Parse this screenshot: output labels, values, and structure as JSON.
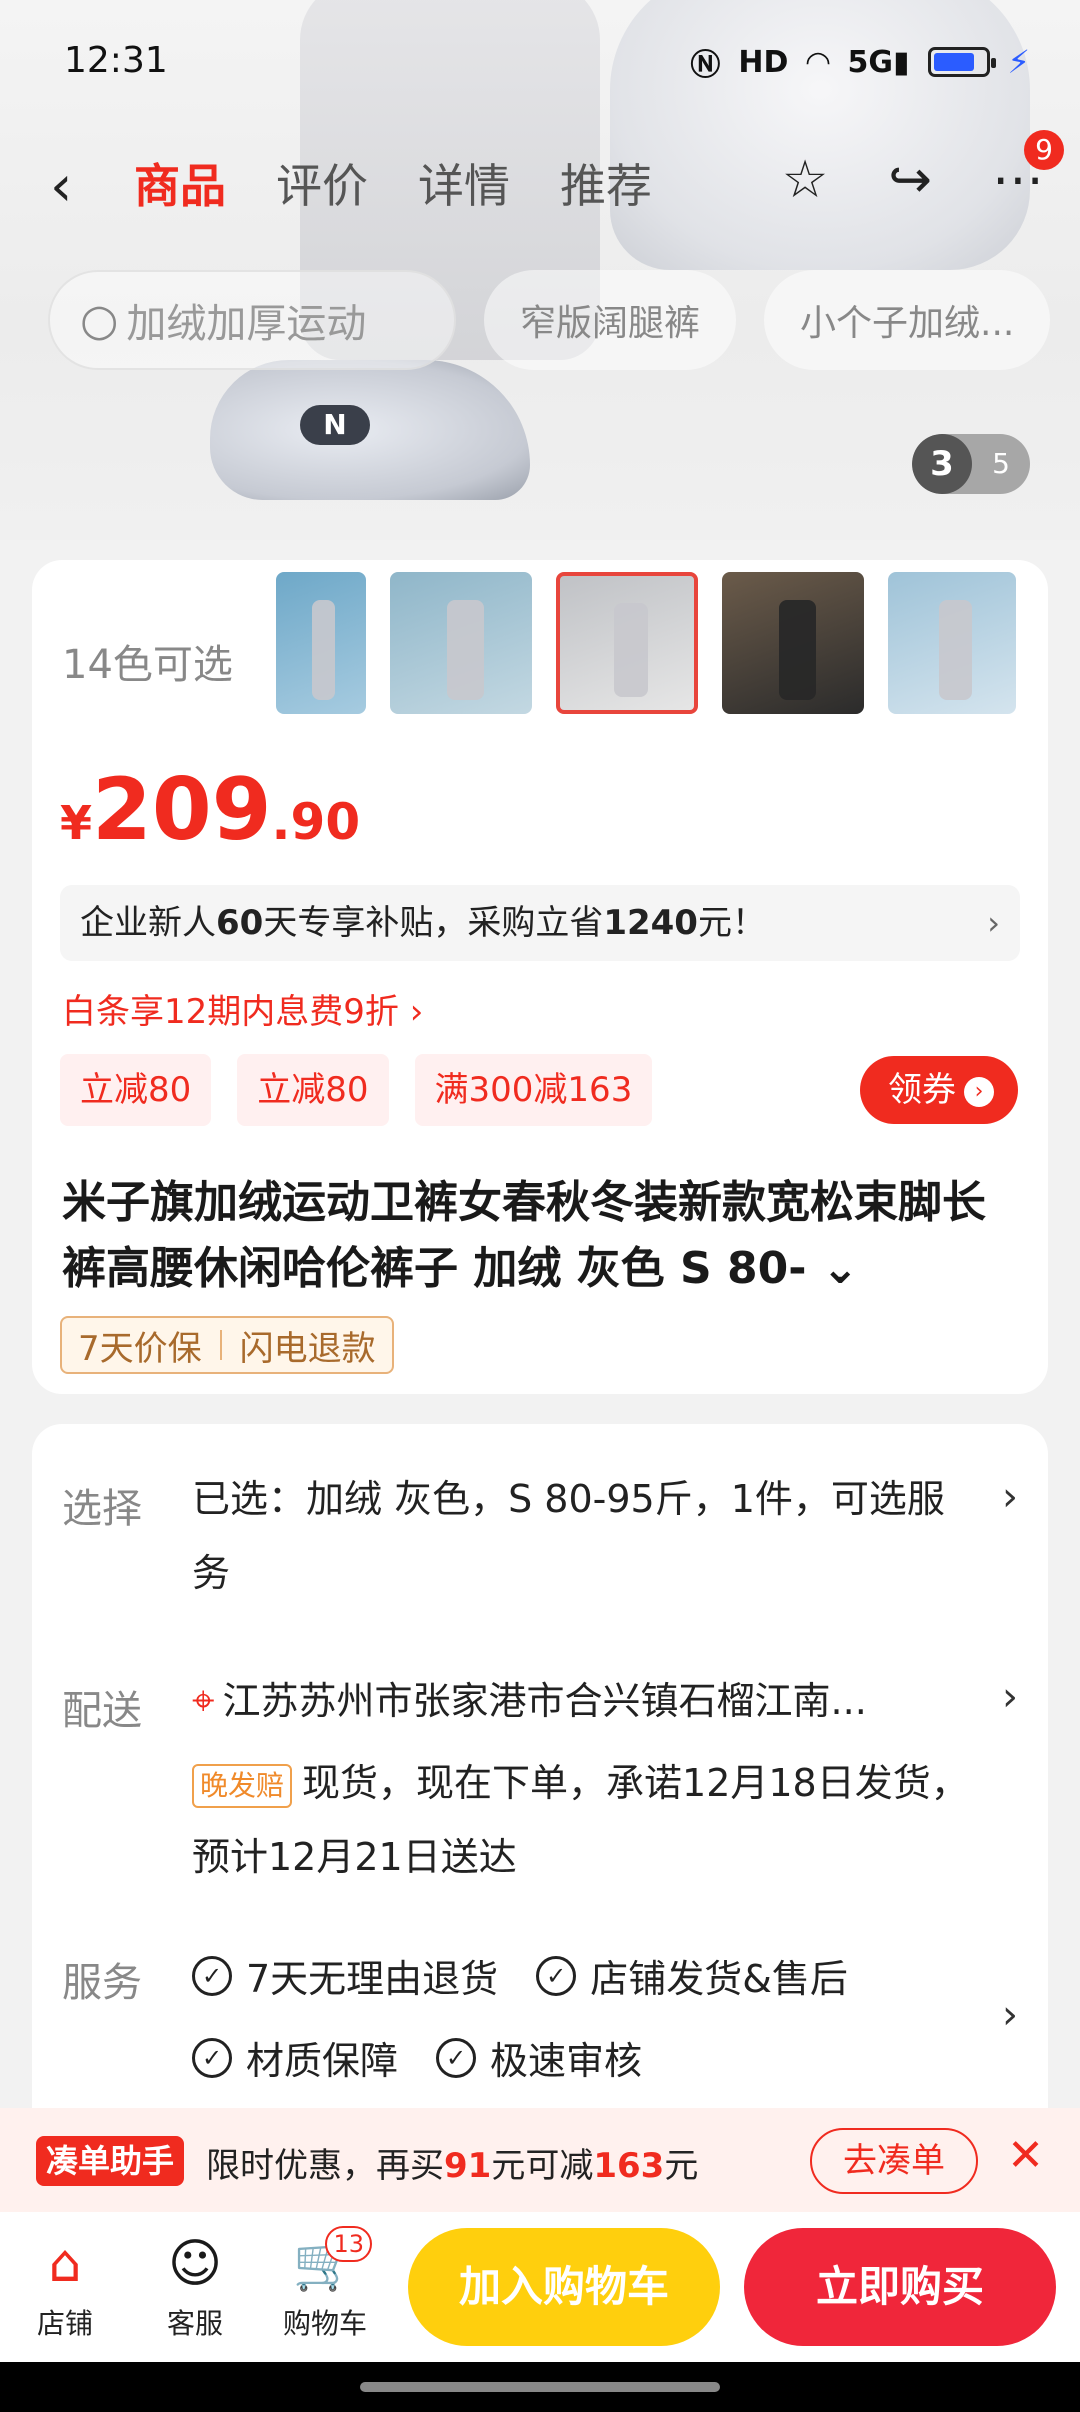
{
  "status_bar": {
    "time": "12:31",
    "icons": [
      "nfc-icon",
      "hd-icon",
      "wifi-icon",
      "5g-signal-icon",
      "battery-icon",
      "charging-icon"
    ],
    "network": "5G",
    "hd": "HD"
  },
  "nav": {
    "tabs": [
      {
        "label": "商品",
        "active": true
      },
      {
        "label": "评价",
        "active": false
      },
      {
        "label": "详情",
        "active": false
      },
      {
        "label": "推荐",
        "active": false
      }
    ],
    "more_badge": "9"
  },
  "search": {
    "placeholder": "加绒加厚运动",
    "chips": [
      "窄版阔腿裤",
      "小个子加绒..."
    ]
  },
  "image_counter": {
    "current": "3",
    "total": "5"
  },
  "product": {
    "colors_label": "14色可选",
    "price": {
      "currency": "¥",
      "integer": "209",
      "decimal": ".90"
    },
    "subsidy": {
      "prefix": "企业新人",
      "days": "60",
      "mid": "天专享补贴，采购立省",
      "amount": "1240",
      "suffix": "元！",
      "arrow": "›"
    },
    "baitiao": "白条享12期内息费9折 ›",
    "promos": [
      "立减80",
      "立减80",
      "满300减163"
    ],
    "coupon_label": "领券",
    "title": "米子旗加绒运动卫裤女春秋冬装新款宽松束脚长裤高腰休闲哈伦裤子 加绒 灰色 S 80- ⌄",
    "guarantees": [
      "7天价保",
      "闪电退款"
    ]
  },
  "selection": {
    "select_label": "选择",
    "select_text": "已选：加绒 灰色，S 80-95斤，1件，可选服务",
    "delivery_label": "配送",
    "address": "江苏苏州市张家港市合兴镇石榴江南...",
    "late_tag": "晚发赔",
    "delivery_text": "现货，现在下单，承诺12月18日发货，预计12月21日送达",
    "service_label": "服务",
    "services": [
      "7天无理由退货",
      "店铺发货&售后",
      "材质保障",
      "极速审核"
    ]
  },
  "helper": {
    "tag": "凑单助手",
    "text_a": "限时优惠，再买",
    "amount1": "91",
    "text_b": "元可减",
    "amount2": "163",
    "text_c": "元",
    "button": "去凑单"
  },
  "bottom": {
    "store": "店铺",
    "service": "客服",
    "cart": "购物车",
    "cart_badge": "13",
    "add_to_cart": "加入购物车",
    "buy_now": "立即购买"
  },
  "colors": {
    "accent": "#f02b1f",
    "cart_button": "#ffcf0d",
    "buy_button": "#f0263a"
  }
}
